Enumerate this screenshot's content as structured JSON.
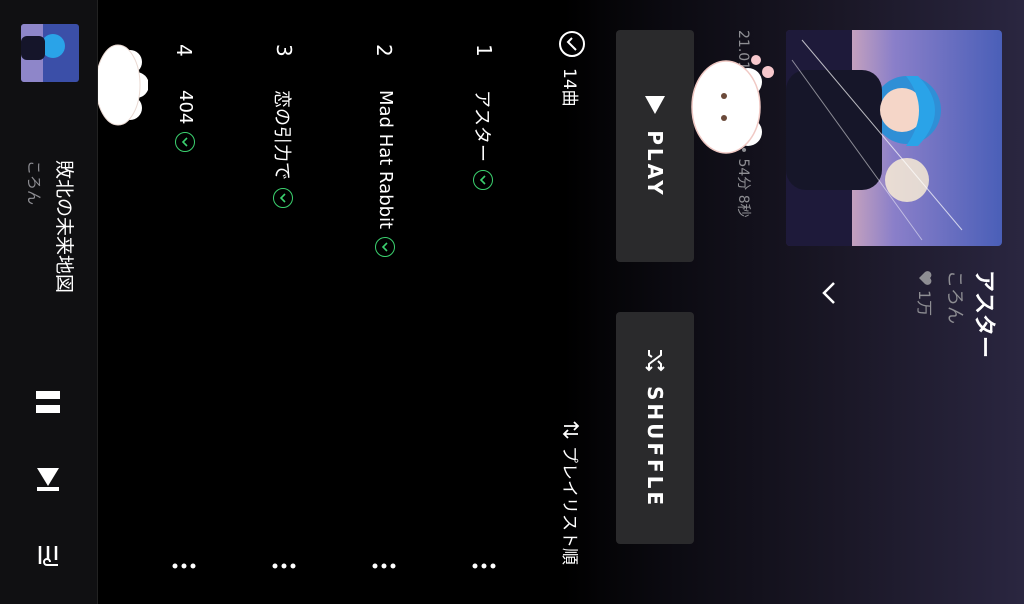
{
  "album": {
    "title": "アスター",
    "artist": "ころん",
    "likes": "1万",
    "meta": "21.01.27 • 14曲 • 54分 8秒"
  },
  "buttons": {
    "play": "PLAY",
    "shuffle": "SHUFFLE"
  },
  "list": {
    "count": "14曲",
    "sort": "プレイリスト順"
  },
  "tracks": [
    {
      "num": "1",
      "title": "アスター"
    },
    {
      "num": "2",
      "title": "Mad Hat Rabbit"
    },
    {
      "num": "3",
      "title": "恋の引力で"
    },
    {
      "num": "4",
      "title": "404"
    }
  ],
  "now_playing": {
    "title": "敗北の未来地図",
    "artist": "ころん"
  },
  "colors": {
    "accent": "#3bd16f",
    "button_bg": "#2a2a2c",
    "background": "#000000"
  },
  "icons": [
    "collapse-chevron-icon",
    "heart-icon",
    "play-icon",
    "shuffle-icon",
    "download-check-icon",
    "sort-icon",
    "more-vertical-icon",
    "pause-icon",
    "skip-next-icon",
    "queue-icon"
  ]
}
